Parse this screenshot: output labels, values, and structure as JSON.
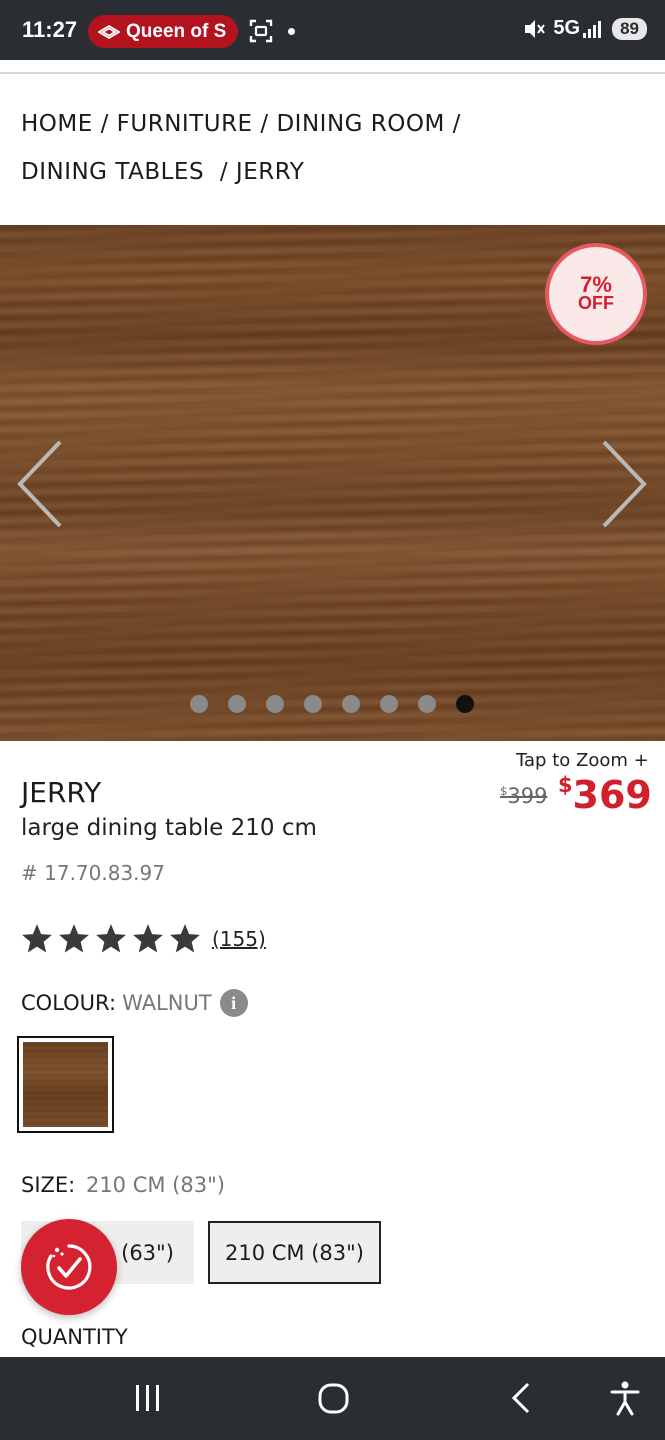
{
  "status_bar": {
    "time": "11:27",
    "app_notification": "Queen of S",
    "network": "5G",
    "battery": "89"
  },
  "breadcrumb": {
    "items": [
      "HOME",
      "FURNITURE",
      "DINING ROOM",
      "DINING TABLES",
      "JERRY"
    ],
    "separator": "/"
  },
  "hero": {
    "badge_percent": "7%",
    "badge_label": "OFF",
    "slide_count": 8,
    "active_slide": 8
  },
  "product": {
    "zoom_label": "Tap to Zoom +",
    "name": "JERRY",
    "description": "large dining table 210 cm",
    "sku": "# 17.70.83.97",
    "old_price_symbol": "$",
    "old_price": "399",
    "price_symbol": "$",
    "price": "369",
    "rating_stars": 5,
    "review_count": "(155)",
    "colour_label": "COLOUR:",
    "colour_value": "WALNUT",
    "info_icon_glyph": "i",
    "size_label": "SIZE:",
    "size_value": "210 CM (83\")",
    "size_options": [
      "1 (63\")",
      "210 CM (83\")"
    ],
    "quantity_label": "QUANTITY"
  },
  "colors": {
    "brand_red": "#d11f2c",
    "status_bar_bg": "#2a2d31"
  }
}
